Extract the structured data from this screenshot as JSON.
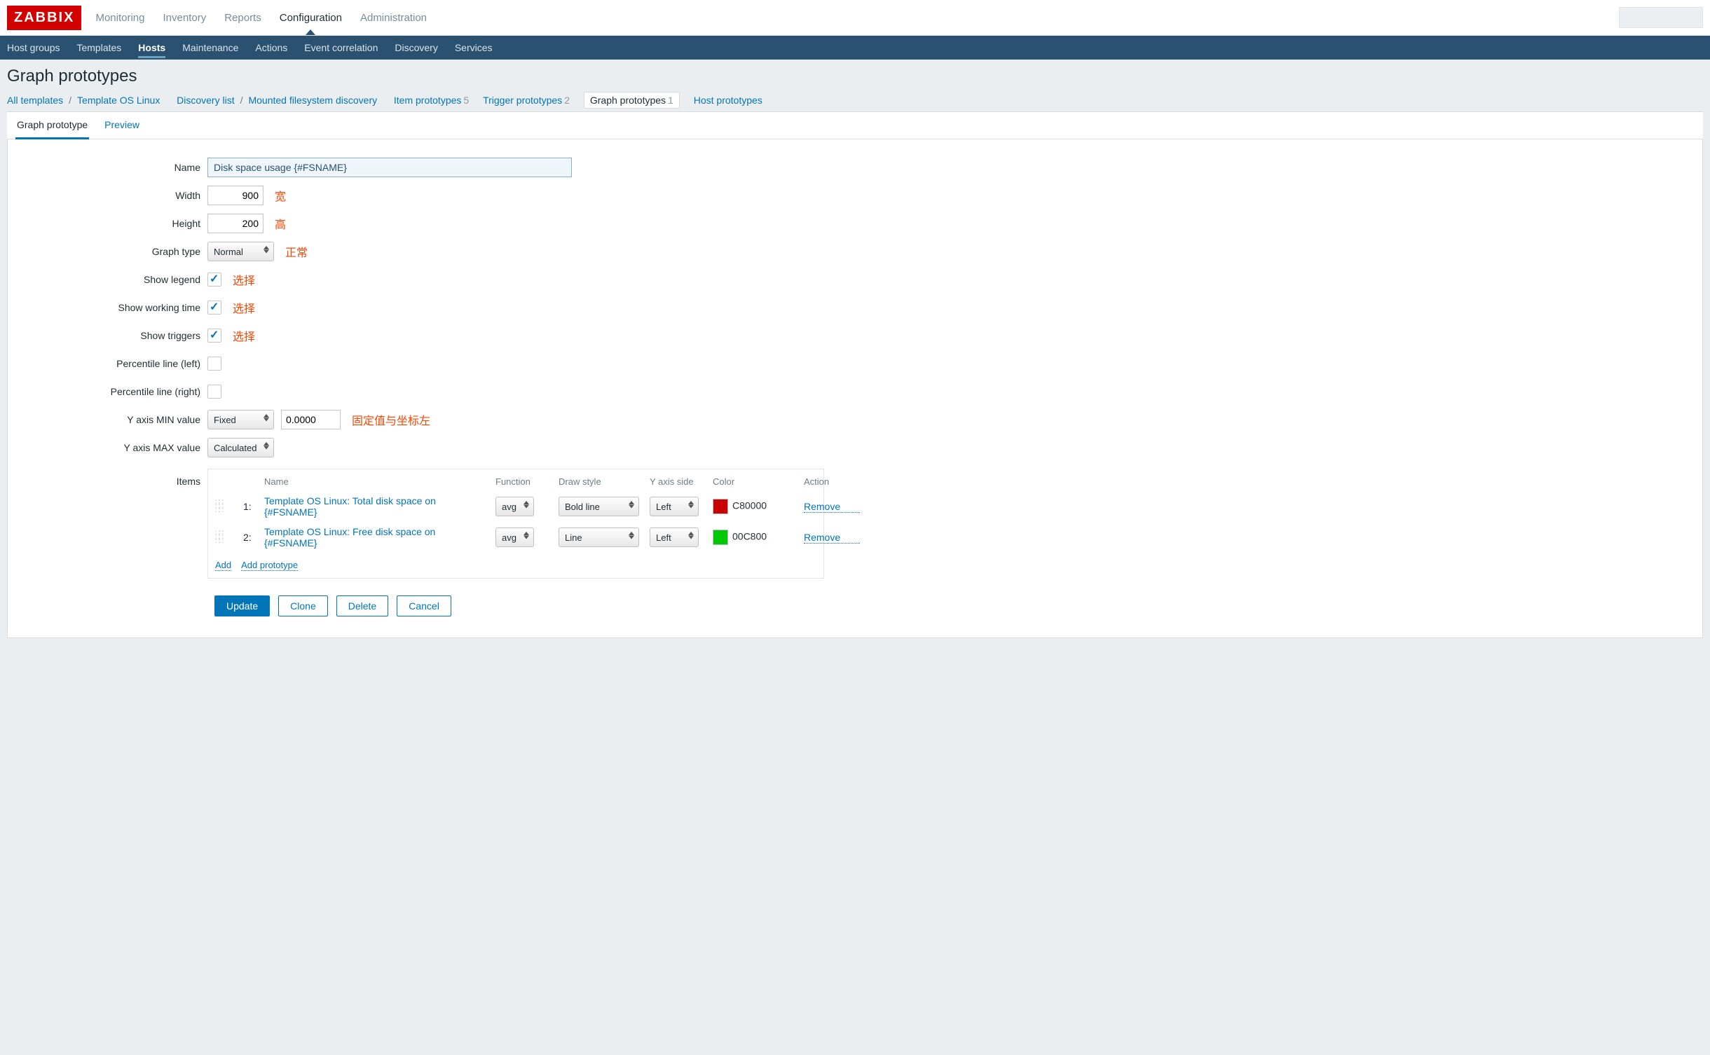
{
  "brand": "ZABBIX",
  "topnav": {
    "monitoring": "Monitoring",
    "inventory": "Inventory",
    "reports": "Reports",
    "configuration": "Configuration",
    "administration": "Administration"
  },
  "subnav": {
    "host_groups": "Host groups",
    "templates": "Templates",
    "hosts": "Hosts",
    "maintenance": "Maintenance",
    "actions": "Actions",
    "event_correlation": "Event correlation",
    "discovery": "Discovery",
    "services": "Services"
  },
  "page_title": "Graph prototypes",
  "breadcrumbs": {
    "all_templates": "All templates",
    "template_os_linux": "Template OS Linux",
    "discovery_list": "Discovery list",
    "mounted_fs": "Mounted filesystem discovery",
    "item_proto": "Item prototypes",
    "item_proto_count": "5",
    "trigger_proto": "Trigger prototypes",
    "trigger_proto_count": "2",
    "graph_proto": "Graph prototypes",
    "graph_proto_count": "1",
    "host_proto": "Host prototypes"
  },
  "tabs": {
    "graph_prototype": "Graph prototype",
    "preview": "Preview"
  },
  "form": {
    "labels": {
      "name": "Name",
      "width": "Width",
      "height": "Height",
      "graph_type": "Graph type",
      "show_legend": "Show legend",
      "show_working_time": "Show working time",
      "show_triggers": "Show triggers",
      "percentile_left": "Percentile line (left)",
      "percentile_right": "Percentile line (right)",
      "y_min": "Y axis MIN value",
      "y_max": "Y axis MAX value",
      "items": "Items"
    },
    "values": {
      "name": "Disk space usage {#FSNAME}",
      "width": "900",
      "height": "200",
      "graph_type": "Normal",
      "y_min_type": "Fixed",
      "y_min_value": "0.0000",
      "y_max_type": "Calculated"
    },
    "annotations": {
      "width": "宽",
      "height": "高",
      "graph_type": "正常",
      "show_legend": "选择",
      "show_working_time": "选择",
      "show_triggers": "选择",
      "y_min": "固定值与坐标左"
    }
  },
  "items_table": {
    "headers": {
      "name": "Name",
      "function": "Function",
      "draw_style": "Draw style",
      "y_axis_side": "Y axis side",
      "color": "Color",
      "action": "Action"
    },
    "rows": [
      {
        "idx": "1:",
        "name": "Template OS Linux: Total disk space on {#FSNAME}",
        "function": "avg",
        "draw_style": "Bold line",
        "y_axis_side": "Left",
        "color": "C80000",
        "remove": "Remove"
      },
      {
        "idx": "2:",
        "name": "Template OS Linux: Free disk space on {#FSNAME}",
        "function": "avg",
        "draw_style": "Line",
        "y_axis_side": "Left",
        "color": "00C800",
        "remove": "Remove"
      }
    ],
    "add": "Add",
    "add_prototype": "Add prototype"
  },
  "buttons": {
    "update": "Update",
    "clone": "Clone",
    "delete": "Delete",
    "cancel": "Cancel"
  }
}
